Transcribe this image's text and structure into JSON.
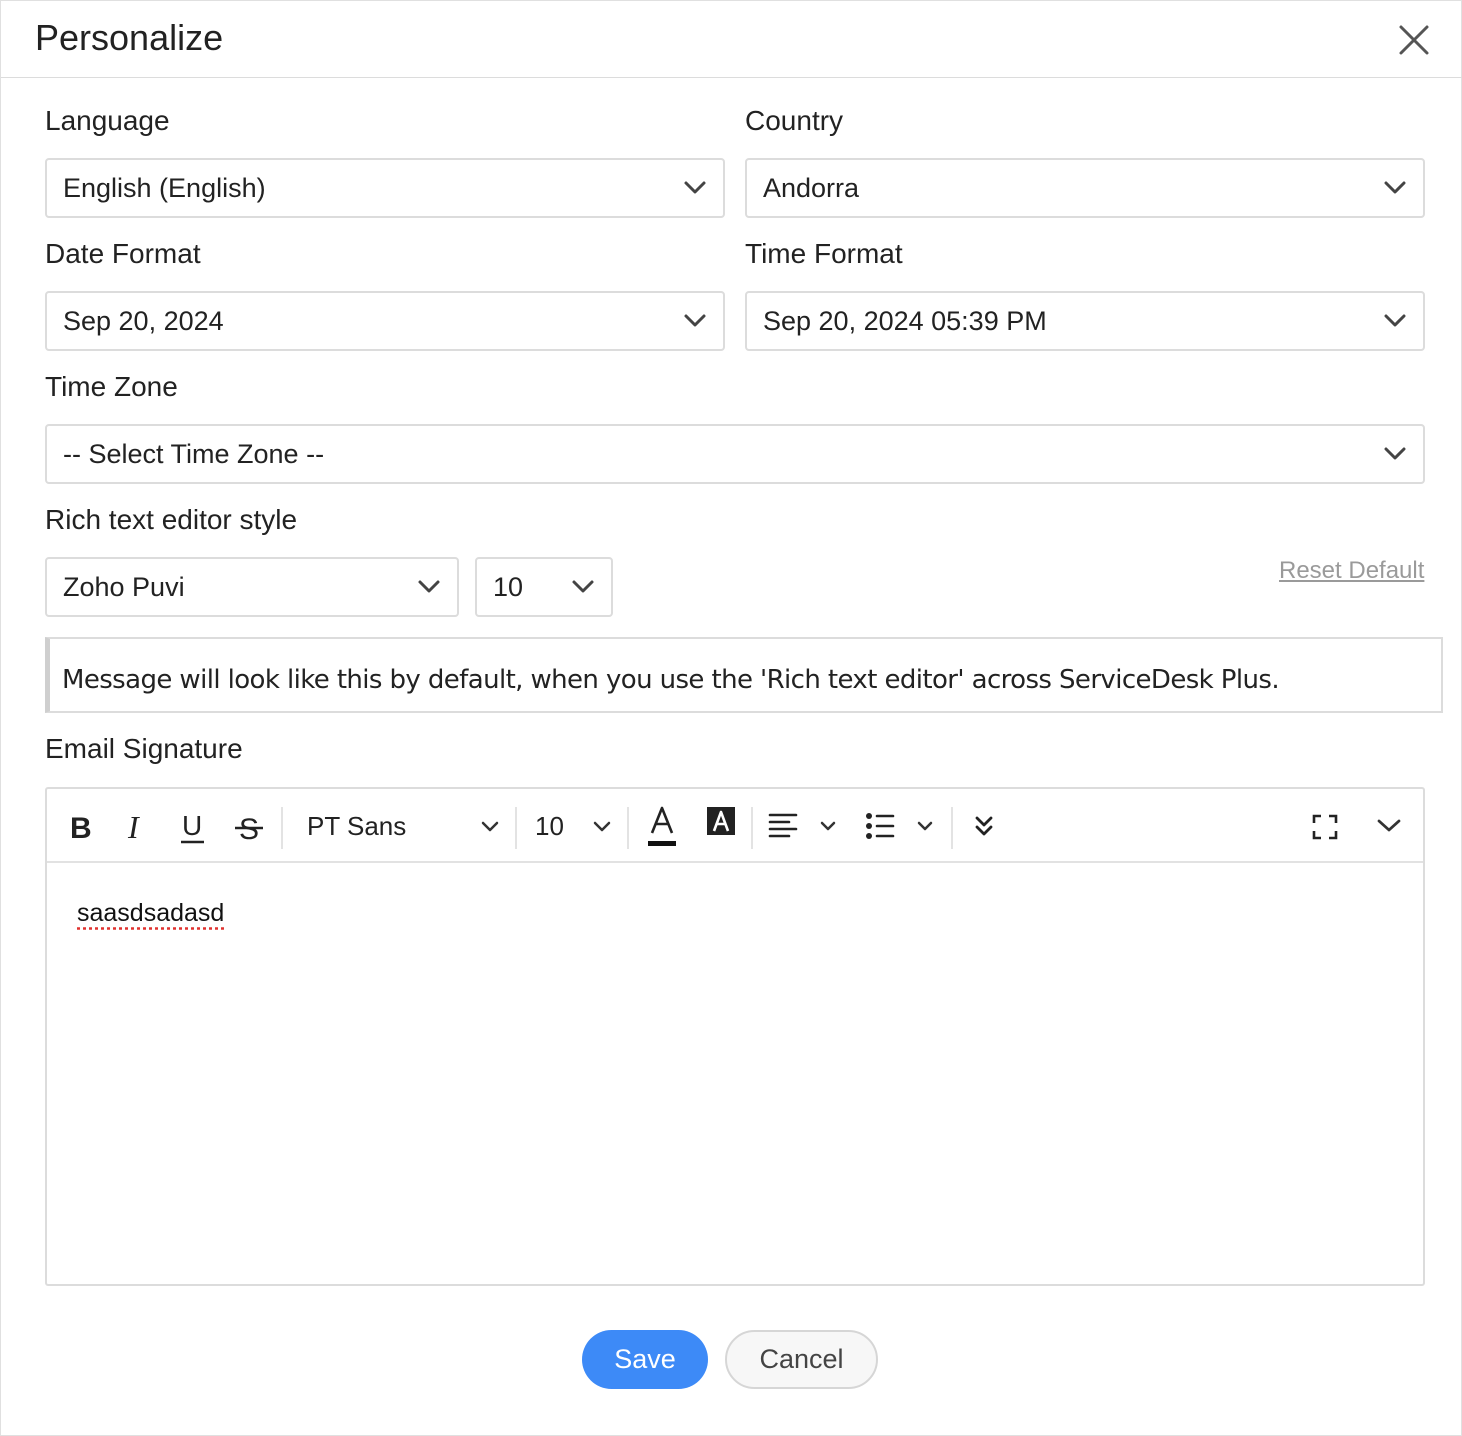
{
  "dialog": {
    "title": "Personalize"
  },
  "fields": {
    "language": {
      "label": "Language",
      "value": "English (English)"
    },
    "country": {
      "label": "Country",
      "value": "Andorra"
    },
    "date_format": {
      "label": "Date Format",
      "value": "Sep 20, 2024"
    },
    "time_format": {
      "label": "Time Format",
      "value": "Sep 20, 2024 05:39 PM"
    },
    "time_zone": {
      "label": "Time Zone",
      "value": "-- Select Time Zone --"
    },
    "rich_text": {
      "label": "Rich text editor style",
      "font": "Zoho Puvi",
      "size": "10",
      "reset_label": "Reset Default",
      "preview_text": "Message will look like this by default, when you use the 'Rich text editor' across ServiceDesk Plus."
    }
  },
  "signature": {
    "label": "Email Signature",
    "toolbar": {
      "bold": "B",
      "italic": "I",
      "underline": "U",
      "strike": "S",
      "font": "PT Sans",
      "size": "10",
      "icons": [
        "bold-icon",
        "italic-icon",
        "underline-icon",
        "strikethrough-icon",
        "font-color-icon",
        "highlight-color-icon",
        "align-left-icon",
        "bullet-list-icon",
        "more-icon",
        "fullscreen-icon",
        "collapse-icon"
      ]
    },
    "content": "saasdsadasd"
  },
  "actions": {
    "save": "Save",
    "cancel": "Cancel"
  },
  "colors": {
    "primary": "#3d8af7",
    "border": "#dcdcdc",
    "spellcheck": "#e0322f"
  }
}
